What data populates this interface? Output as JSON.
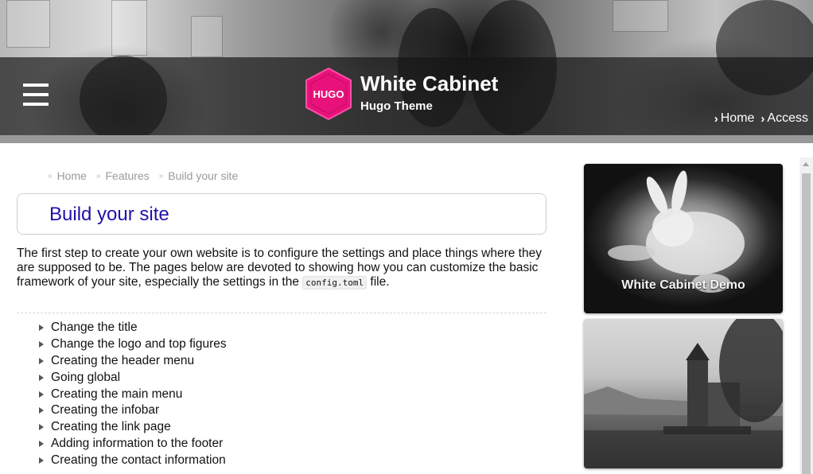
{
  "header": {
    "site_title": "White Cabinet",
    "site_subtitle": "Hugo Theme",
    "logo_text": "HUGO",
    "logo_color": "#e8127a",
    "nav": [
      {
        "label": "Home"
      },
      {
        "label": "Access"
      }
    ]
  },
  "breadcrumb": {
    "items": [
      "Home",
      "Features",
      "Build your site"
    ]
  },
  "main": {
    "title": "Build your site",
    "intro_before": "The first step to create your own website is to configure the settings and place things where they are supposed to be. The pages below are devoted to showing how you can customize the basic framework of your site, especially the settings in the ",
    "intro_code": "config.toml",
    "intro_after": " file.",
    "links": [
      "Change the title",
      "Change the logo and top figures",
      "Creating the header menu",
      "Going global",
      "Creating the main menu",
      "Creating the infobar",
      "Creating the link page",
      "Adding information to the footer",
      "Creating the contact information"
    ]
  },
  "sidebar": {
    "demo_caption": "White Cabinet Demo"
  },
  "colors": {
    "title_color": "#1f11a8",
    "header_band": "#141414"
  }
}
